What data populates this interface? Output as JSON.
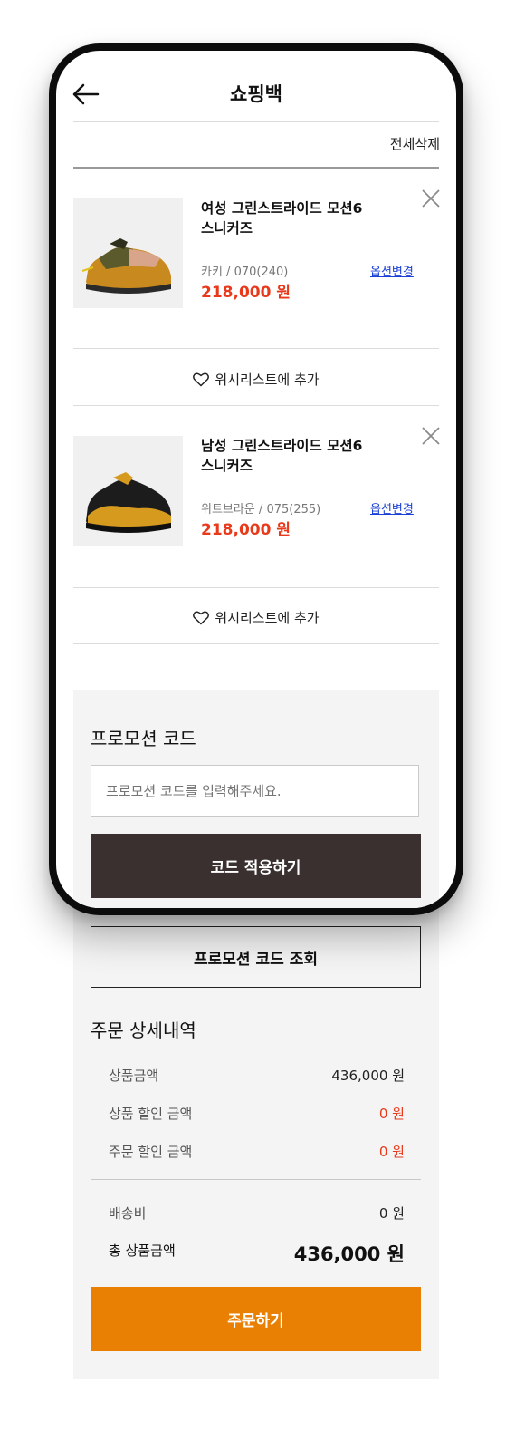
{
  "header": {
    "title": "쇼핑백",
    "back_icon": "arrow-left-icon"
  },
  "cart": {
    "delete_all_label": "전체삭제",
    "items": [
      {
        "name_line1": "여성 그린스트라이드 모션6",
        "name_line2": "스니커즈",
        "option": "카키 / 070(240)",
        "price": "218,000 원",
        "change_option": "옵션변경",
        "wishlist_label": "위시리스트에 추가"
      },
      {
        "name_line1": "남성 그린스트라이드 모션6",
        "name_line2": "스니커즈",
        "option": "위트브라운 / 075(255)",
        "price": "218,000 원",
        "change_option": "옵션변경",
        "wishlist_label": "위시리스트에 추가"
      }
    ]
  },
  "promo": {
    "title": "프로모션 코드",
    "input_placeholder": "프로모션 코드를 입력해주세요.",
    "apply_label": "코드 적용하기",
    "lookup_label": "프로모션 코드 조회"
  },
  "order_summary": {
    "title": "주문 상세내역",
    "product_amount_label": "상품금액",
    "product_amount_value": "436,000 원",
    "product_discount_label": "상품 할인 금액",
    "product_discount_value": "0 원",
    "order_discount_label": "주문 할인 금액",
    "order_discount_value": "0 원",
    "shipping_label": "배송비",
    "shipping_value": "0 원",
    "total_label": "총 상품금액",
    "total_value": "436,000 원"
  },
  "checkout_label": "주문하기",
  "colors": {
    "accent_orange": "#e98004",
    "price_red": "#e8391a",
    "dark_button": "#3a3030",
    "link_blue": "#1a3fd6"
  }
}
